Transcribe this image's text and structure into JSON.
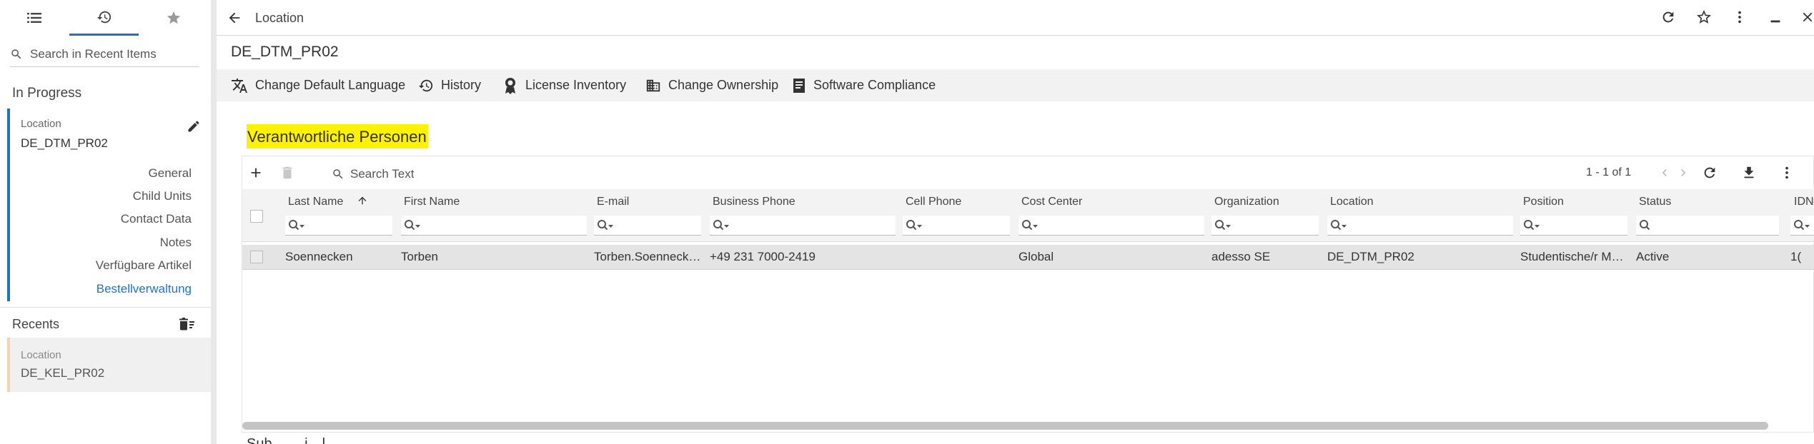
{
  "left_panel": {
    "tabs": [
      {
        "icon": "list-icon"
      },
      {
        "icon": "history-icon",
        "active": true
      },
      {
        "icon": "star-icon"
      }
    ],
    "search_placeholder": "Search in Recent Items",
    "in_progress_title": "In Progress",
    "current_item": {
      "type": "Location",
      "name": "DE_DTM_PR02",
      "edit_icon": "pencil-icon"
    },
    "nav_links": [
      "General",
      "Child Units",
      "Contact Data",
      "Notes",
      "Verfügbare Artikel",
      "Bestellverwaltung"
    ],
    "active_nav": "Bestellverwaltung",
    "recents_title": "Recents",
    "recent_item": {
      "type": "Location",
      "name": "DE_KEL_PR02"
    }
  },
  "header": {
    "back_icon": "arrow-left-icon",
    "title": "Location",
    "icons": [
      "refresh-icon",
      "star-outline-icon",
      "more-vert-icon",
      "minimize-icon",
      "close-icon"
    ]
  },
  "object_title": "DE_DTM_PR02",
  "actions": [
    {
      "label": "Change Default Language",
      "icon": "translate-icon"
    },
    {
      "label": "History",
      "icon": "history-icon"
    },
    {
      "label": "License Inventory",
      "icon": "license-icon"
    },
    {
      "label": "Change Ownership",
      "icon": "building-icon"
    },
    {
      "label": "Software Compliance",
      "icon": "compliance-icon"
    }
  ],
  "section_title": "Verantwortliche Personen",
  "highlight_color": "#fff200",
  "accent_color": "#1e73c8",
  "grid": {
    "search_placeholder": "Search Text",
    "pagination": "1 - 1 of 1",
    "columns": [
      "Last Name",
      "First Name",
      "E-mail",
      "Business Phone",
      "Cell Phone",
      "Cost Center",
      "Organization",
      "Location",
      "Position",
      "Status",
      "IDN"
    ],
    "sorted_column": "Last Name",
    "rows": [
      {
        "cells": [
          "Soennecken",
          "Torben",
          "Torben.Soenneck…",
          "+49 231 7000-2419",
          "",
          "Global",
          "adesso SE",
          "DE_DTM_PR02",
          "Studentische/r M…",
          "Active",
          "1("
        ]
      }
    ]
  },
  "next_section_title": "Sub…  …i…l…"
}
